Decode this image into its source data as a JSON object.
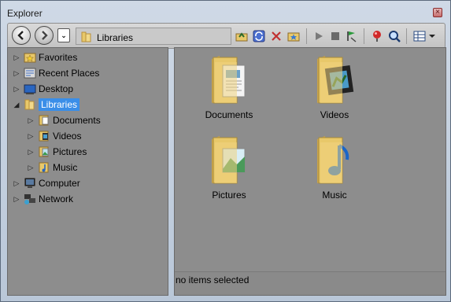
{
  "window": {
    "title": "Explorer",
    "close_icon": "close-icon"
  },
  "toolbar": {
    "address_text": "Libraries",
    "icons": [
      "back-icon",
      "forward-icon",
      "history-icon",
      "folder-up-icon",
      "sync-icon",
      "delete-icon",
      "new-folder-icon",
      "play-icon",
      "stop-icon",
      "flag-icon",
      "pin-icon",
      "search-icon",
      "view-icon"
    ]
  },
  "tree": {
    "items": [
      {
        "label": "Favorites",
        "icon": "star-folder-icon",
        "expanded": false
      },
      {
        "label": "Recent Places",
        "icon": "recent-places-icon",
        "expanded": false
      },
      {
        "label": "Desktop",
        "icon": "desktop-icon",
        "expanded": false
      },
      {
        "label": "Libraries",
        "icon": "libraries-icon",
        "expanded": true,
        "selected": true
      },
      {
        "label": "Documents",
        "icon": "documents-library-icon",
        "expanded": false
      },
      {
        "label": "Videos",
        "icon": "videos-library-icon",
        "expanded": false
      },
      {
        "label": "Pictures",
        "icon": "pictures-library-icon",
        "expanded": false
      },
      {
        "label": "Music",
        "icon": "music-library-icon",
        "expanded": false
      },
      {
        "label": "Computer",
        "icon": "computer-icon",
        "expanded": false
      },
      {
        "label": "Network",
        "icon": "network-icon",
        "expanded": false
      }
    ]
  },
  "libraries": [
    {
      "label": "Documents",
      "icon": "documents-folder-icon"
    },
    {
      "label": "Videos",
      "icon": "videos-folder-icon"
    },
    {
      "label": "Pictures",
      "icon": "pictures-folder-icon"
    },
    {
      "label": "Music",
      "icon": "music-folder-icon"
    }
  ],
  "status": {
    "text": "no items selected"
  },
  "colors": {
    "selection": "#3a8ee8",
    "pane_bg": "#8d8d8d",
    "folder": "#e8c86a"
  }
}
